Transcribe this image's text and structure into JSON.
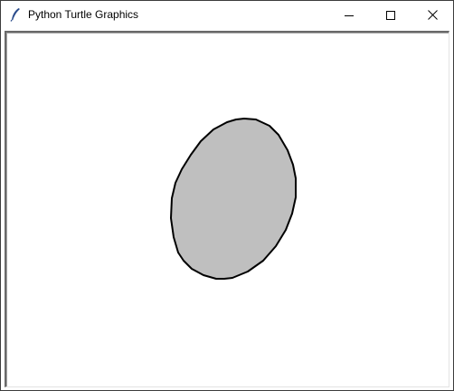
{
  "window": {
    "title": "Python Turtle Graphics",
    "app_icon": "feather-icon",
    "controls": {
      "minimize_icon": "minimize-icon",
      "maximize_icon": "maximize-icon",
      "close_icon": "close-icon"
    }
  },
  "canvas": {
    "background": "#ffffff",
    "shape": {
      "type": "ellipse",
      "fill": "#bfbfbf",
      "stroke": "#000000"
    }
  }
}
